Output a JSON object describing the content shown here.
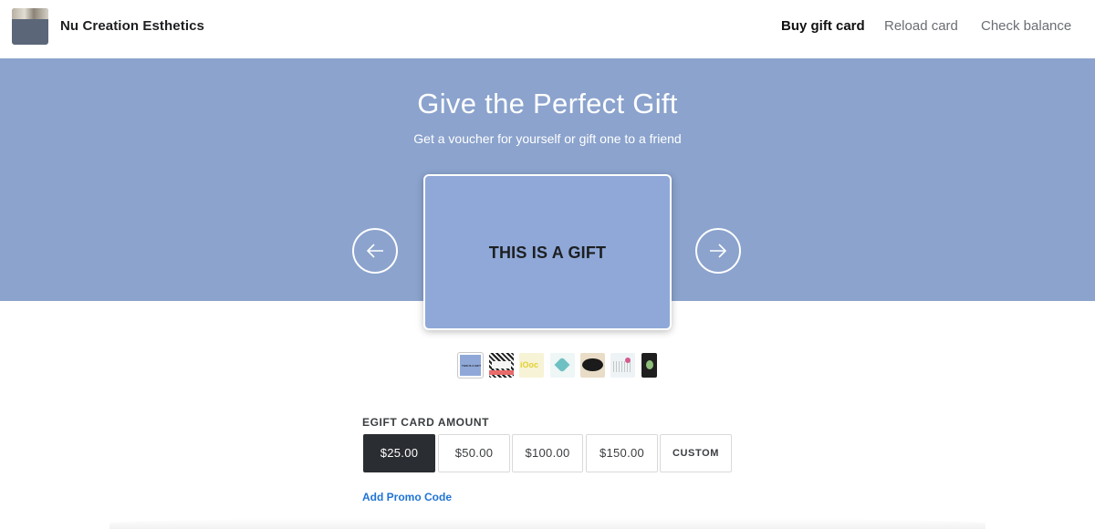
{
  "header": {
    "brand": "Nu Creation Esthetics",
    "nav": {
      "buy_gift_card": "Buy gift card",
      "reload_card": "Reload card",
      "check_balance": "Check balance"
    },
    "active_nav": "Buy gift card"
  },
  "hero": {
    "title": "Give the Perfect Gift",
    "subtitle": "Get a voucher for yourself or gift one to a friend",
    "background_color": "#8ba3cd",
    "card": {
      "text": "THIS IS A GIFT",
      "color": "#8fa8d8"
    },
    "prev_icon": "arrow-left-icon",
    "next_icon": "arrow-right-icon"
  },
  "designs": {
    "selected_index": 0,
    "thumb_1_text": "THIS IS A GIFT"
  },
  "amount": {
    "label": "EGIFT CARD AMOUNT",
    "options": [
      "$25.00",
      "$50.00",
      "$100.00",
      "$150.00",
      "CUSTOM"
    ],
    "selected": "$25.00"
  },
  "promo": {
    "label": "Add Promo Code"
  },
  "colors": {
    "accent_link": "#1f74d6",
    "selected_amount": "#2a2d31"
  }
}
